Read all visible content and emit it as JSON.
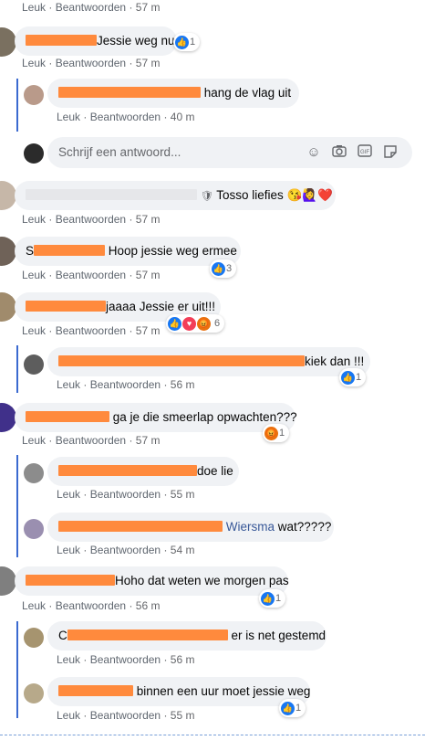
{
  "actions": {
    "like": "Leuk",
    "reply": "Beantwoorden",
    "sep": "·"
  },
  "top": {
    "time": "57 m"
  },
  "comments": [
    {
      "text": "Jessie weg nu",
      "time": "57 m",
      "reactions": "1"
    },
    {
      "text": "hang de vlag uit",
      "time": "40 m"
    },
    {
      "text": "Tosso liefies",
      "emoji": "😘🙋‍♀️❤️",
      "time": "57 m"
    },
    {
      "text": "Hoop jessie weg ermee",
      "time": "57 m",
      "reactions": "3",
      "name_prefix": "S"
    },
    {
      "text": "jaaaa Jessie er uit!!!",
      "time": "57 m",
      "reactions": "6"
    },
    {
      "text": "kiek dan !!!",
      "time": "56 m",
      "reactions": "1"
    },
    {
      "text": "ga je die smeerlap opwachten???",
      "time": "57 m",
      "reactions": "1"
    },
    {
      "text": "doe lie",
      "time": "55 m"
    },
    {
      "text": "Wiersma",
      "text2": "wat?????",
      "time": "54 m"
    },
    {
      "text": "Hoho dat weten we morgen pas",
      "time": "56 m",
      "reactions": "1"
    },
    {
      "text": "er is net gestemd",
      "time": "56 m",
      "name_prefix": "C"
    },
    {
      "text": "binnen een uur moet jessie weg",
      "time": "55 m",
      "reactions": "1"
    }
  ],
  "reply_box": {
    "placeholder": "Schrijf een antwoord..."
  },
  "icons": {
    "emoji": "smiley-icon",
    "camera": "camera-icon",
    "gif": "gif-icon",
    "sticker": "sticker-icon",
    "shield": "shield-icon"
  },
  "colors": {
    "like_blue": "#1877f2",
    "thread_line": "#3b6ad0",
    "bubble": "#f0f2f5",
    "redaction": "#ff8a3d"
  }
}
